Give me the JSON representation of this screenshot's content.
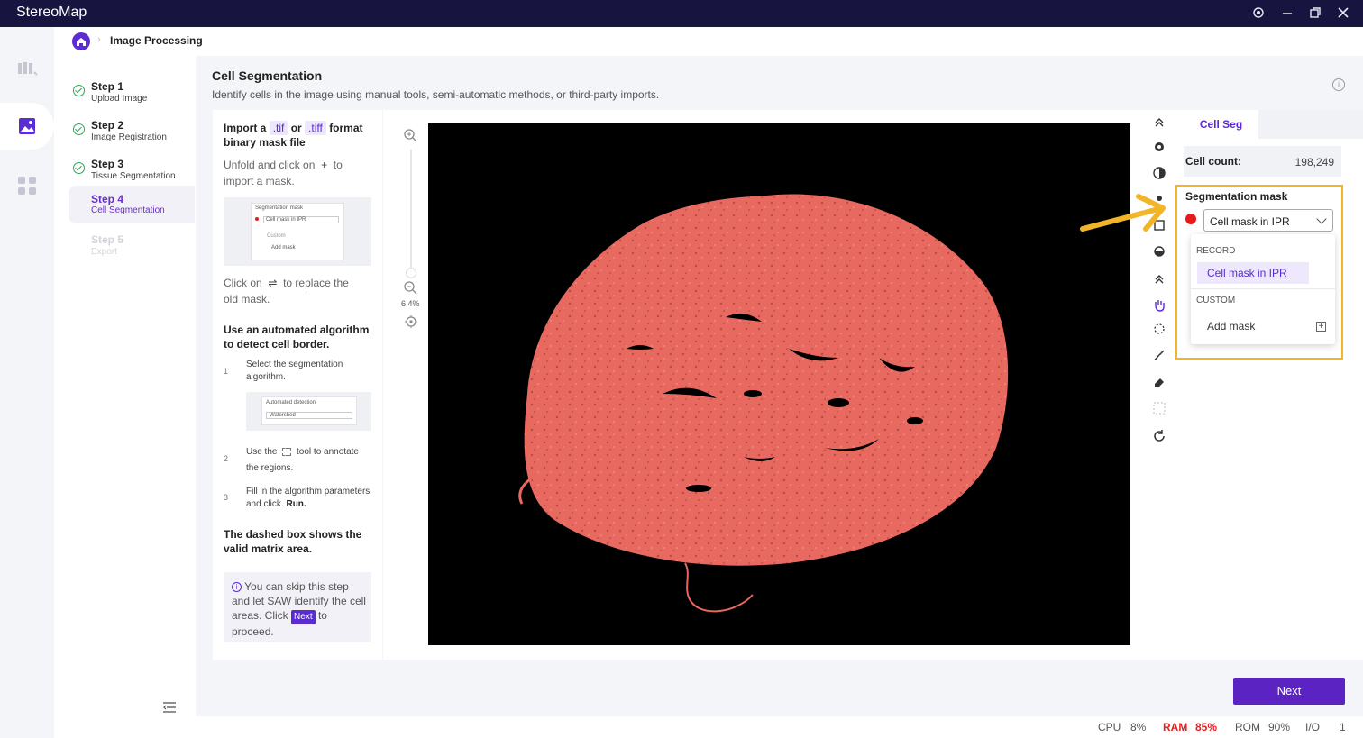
{
  "window": {
    "title": "StereoMap"
  },
  "breadcrumb": {
    "label": "Image Processing"
  },
  "steps": [
    {
      "title": "Step 1",
      "subtitle": "Upload Image",
      "state": "done"
    },
    {
      "title": "Step 2",
      "subtitle": "Image Registration",
      "state": "done"
    },
    {
      "title": "Step 3",
      "subtitle": "Tissue Segmentation",
      "state": "done"
    },
    {
      "title": "Step 4",
      "subtitle": "Cell Segmentation",
      "state": "active"
    },
    {
      "title": "Step 5",
      "subtitle": "Export",
      "state": "disabled"
    }
  ],
  "page": {
    "title": "Cell Segmentation",
    "subtitle": "Identify cells in the image using manual tools, semi-automatic methods, or third-party imports."
  },
  "guide": {
    "import_a": "Import a",
    "tif": ".tif",
    "or": "or",
    "tiff": ".tiff",
    "format": "format",
    "binary": "binary mask file",
    "unfold": "Unfold and click on",
    "plus": "+",
    "to": "to",
    "import_mask": "import a mask.",
    "mini1_title": "Segmentation mask",
    "mini1_select": "Cell mask in IPR",
    "mini1_custom": "Custom",
    "mini1_add": "Add mask",
    "click_on": "Click on",
    "swap": "⇌",
    "replace": "to replace the",
    "old_mask": "old mask.",
    "auto_heading": "Use an automated algorithm to detect cell border.",
    "n1": "1",
    "item1": "Select the segmentation algorithm.",
    "mini2_title": "Automated detection",
    "mini2_select": "Watershed",
    "n2": "2",
    "item2_a": "Use the",
    "item2_b": "tool to annotate",
    "item2_c": "the regions.",
    "n3": "3",
    "item3": "Fill in the algorithm parameters and click.",
    "run": "Run.",
    "dashed_note": "The dashed box shows the valid matrix area.",
    "skip_text": "You can skip this step and let SAW identify the cell areas. Click",
    "skip_next": "Next",
    "skip_end": "to proceed."
  },
  "zoom": {
    "level": "6.4%"
  },
  "panel": {
    "tab": "Cell Seg",
    "cell_count_label": "Cell count:",
    "cell_count_value": "198,249",
    "seg_mask_title": "Segmentation mask",
    "selected_mask": "Cell mask in IPR",
    "dropdown": {
      "record_header": "RECORD",
      "record_option": "Cell mask in IPR",
      "custom_header": "CUSTOM",
      "add_mask": "Add mask"
    }
  },
  "buttons": {
    "next": "Next"
  },
  "status": {
    "cpu_label": "CPU",
    "cpu_value": "8%",
    "ram_label": "RAM",
    "ram_value": "85%",
    "rom_label": "ROM",
    "rom_value": "90%",
    "io_label": "I/O",
    "io_value": "1"
  },
  "colors": {
    "accent": "#5b2bd3",
    "titlebar": "#17153f",
    "highlight": "#f2b52a",
    "tissue": "#e8695f",
    "ram_alert": "#e02222"
  }
}
